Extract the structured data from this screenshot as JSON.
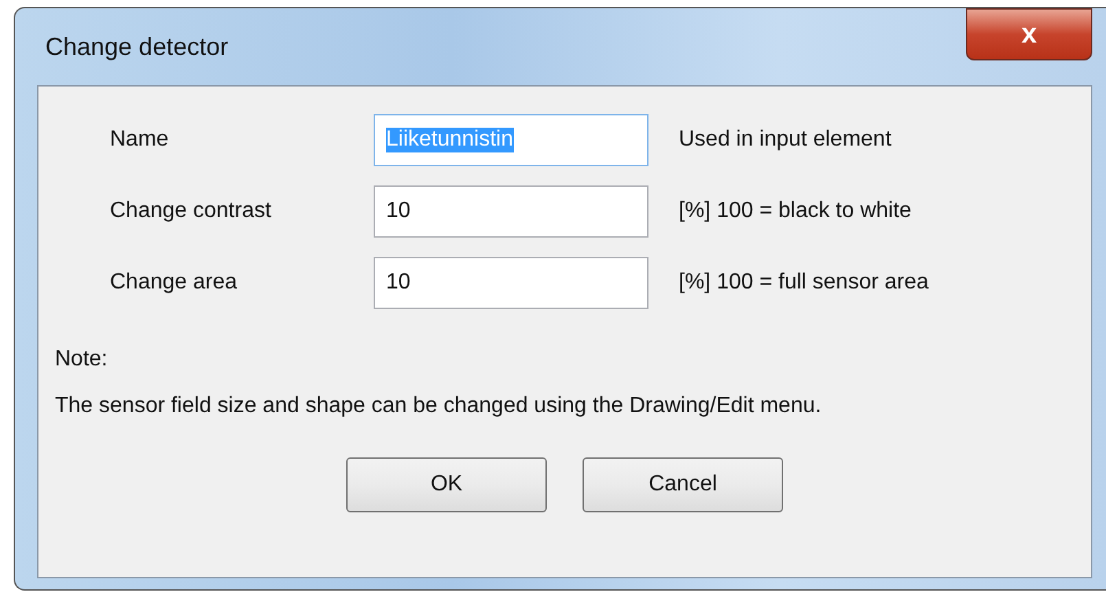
{
  "window": {
    "title": "Change detector",
    "close_label": "x"
  },
  "fields": [
    {
      "label": "Name",
      "value": "Liiketunnistin",
      "hint": "Used in input element",
      "selected": true
    },
    {
      "label": "Change contrast",
      "value": "10",
      "hint": "[%] 100 = black to white",
      "selected": false
    },
    {
      "label": "Change area",
      "value": "10",
      "hint": "[%] 100 = full sensor area",
      "selected": false
    }
  ],
  "note": {
    "heading": "Note:",
    "text": "The sensor field size and shape can be changed using the Drawing/Edit menu."
  },
  "buttons": [
    "OK",
    "Cancel"
  ]
}
